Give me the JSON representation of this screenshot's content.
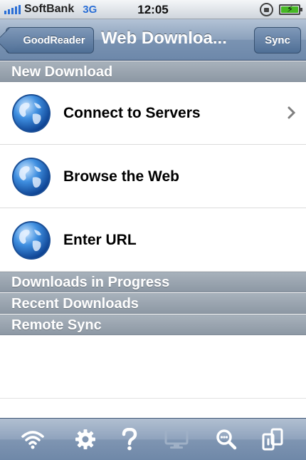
{
  "status_bar": {
    "carrier": "SoftBank",
    "network": "3G",
    "time": "12:05",
    "rotation_lock_icon": "rotation-lock-icon",
    "battery_icon": "battery-charging-icon",
    "signal_bars": 5
  },
  "nav": {
    "back_label": "GoodReader",
    "title": "Web Downloa...",
    "sync_label": "Sync"
  },
  "sections": {
    "new_download": "New Download",
    "in_progress": "Downloads in Progress",
    "recent": "Recent Downloads",
    "remote_sync": "Remote Sync"
  },
  "rows": [
    {
      "label": "Connect to Servers",
      "icon": "globe-icon",
      "chevron": true
    },
    {
      "label": "Browse the Web",
      "icon": "globe-icon",
      "chevron": false
    },
    {
      "label": "Enter URL",
      "icon": "globe-icon",
      "chevron": false
    }
  ],
  "toolbar": {
    "items": [
      {
        "icon": "wifi-icon",
        "enabled": true
      },
      {
        "icon": "gear-icon",
        "enabled": true
      },
      {
        "icon": "help-icon",
        "enabled": true
      },
      {
        "icon": "monitor-icon",
        "enabled": false
      },
      {
        "icon": "search-icon",
        "enabled": true
      },
      {
        "icon": "copy-icon",
        "enabled": true
      }
    ]
  },
  "colors": {
    "nav_bar": "#7a93b2",
    "section_header": "#97a2ad",
    "accent_blue": "#2b6fd6",
    "battery_green": "#46b824"
  }
}
